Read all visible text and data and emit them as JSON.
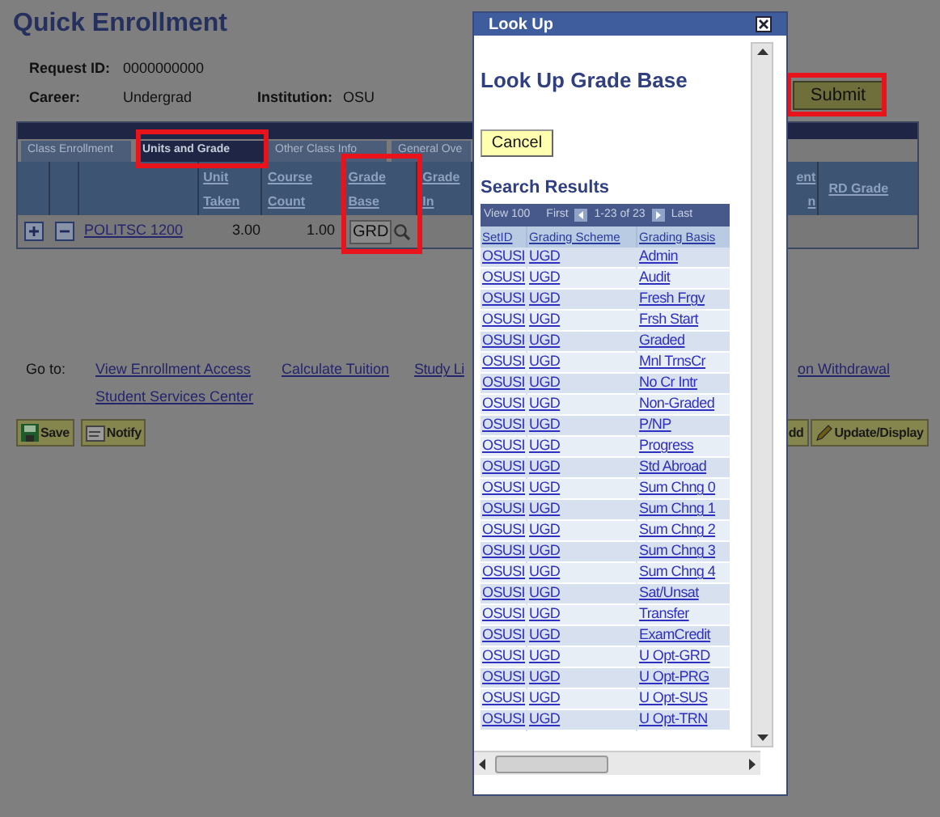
{
  "page": {
    "title": "Quick Enrollment",
    "fields": [
      {
        "label": "Request ID:",
        "value": "0000000000"
      },
      {
        "label": "Career:",
        "value": "Undergrad"
      },
      {
        "label": "Institution:",
        "value": "OSU"
      }
    ],
    "submit_button": "Submit",
    "tabs": [
      {
        "label": "Class Enrollment",
        "selected": false
      },
      {
        "label": "Units and Grade",
        "selected": true
      },
      {
        "label": "Other Class Info",
        "selected": false
      },
      {
        "label": "General Ove",
        "selected": false
      }
    ],
    "grid": {
      "columns": [
        "Unit Taken",
        "Course Count",
        "Grade Base",
        "Grade In",
        "ent n",
        "RD Grade"
      ],
      "rows": [
        {
          "course": "POLITSC 1200",
          "unit_taken": "3.00",
          "course_count": "1.00",
          "grade_base": "GRD"
        }
      ]
    },
    "go_to": {
      "label": "Go to:",
      "links": [
        "View Enrollment Access",
        "Calculate Tuition",
        "Study Li",
        "on Withdrawal",
        "Student Services Center"
      ]
    },
    "buttons": [
      "Save",
      "Notify"
    ],
    "right_buttons": [
      "dd",
      "Update/Display"
    ]
  },
  "modal": {
    "title": "Look Up",
    "heading": "Look Up Grade Base",
    "cancel_button": "Cancel",
    "results_title": "Search Results",
    "nav": {
      "view": "View 100",
      "first": "First",
      "range": "1-23 of 23",
      "last": "Last"
    },
    "columns": [
      "SetID",
      "Grading Scheme",
      "Grading Basis"
    ],
    "rows": [
      [
        "OSUSI",
        "UGD",
        "Admin"
      ],
      [
        "OSUSI",
        "UGD",
        "Audit"
      ],
      [
        "OSUSI",
        "UGD",
        "Fresh Frgv"
      ],
      [
        "OSUSI",
        "UGD",
        "Frsh Start"
      ],
      [
        "OSUSI",
        "UGD",
        "Graded"
      ],
      [
        "OSUSI",
        "UGD",
        "Mnl TrnsCr"
      ],
      [
        "OSUSI",
        "UGD",
        "No Cr Intr"
      ],
      [
        "OSUSI",
        "UGD",
        "Non-Graded"
      ],
      [
        "OSUSI",
        "UGD",
        "P/NP"
      ],
      [
        "OSUSI",
        "UGD",
        "Progress"
      ],
      [
        "OSUSI",
        "UGD",
        "Std Abroad"
      ],
      [
        "OSUSI",
        "UGD",
        "Sum Chng 0"
      ],
      [
        "OSUSI",
        "UGD",
        "Sum Chng 1"
      ],
      [
        "OSUSI",
        "UGD",
        "Sum Chng 2"
      ],
      [
        "OSUSI",
        "UGD",
        "Sum Chng 3"
      ],
      [
        "OSUSI",
        "UGD",
        "Sum Chng 4"
      ],
      [
        "OSUSI",
        "UGD",
        "Sat/Unsat"
      ],
      [
        "OSUSI",
        "UGD",
        "Transfer"
      ],
      [
        "OSUSI",
        "UGD",
        "ExamCredit"
      ],
      [
        "OSUSI",
        "UGD",
        "U Opt-GRD"
      ],
      [
        "OSUSI",
        "UGD",
        "U Opt-PRG"
      ],
      [
        "OSUSI",
        "UGD",
        "U Opt-SUS"
      ],
      [
        "OSUSI",
        "UGD",
        "U Opt-TRN"
      ]
    ]
  }
}
